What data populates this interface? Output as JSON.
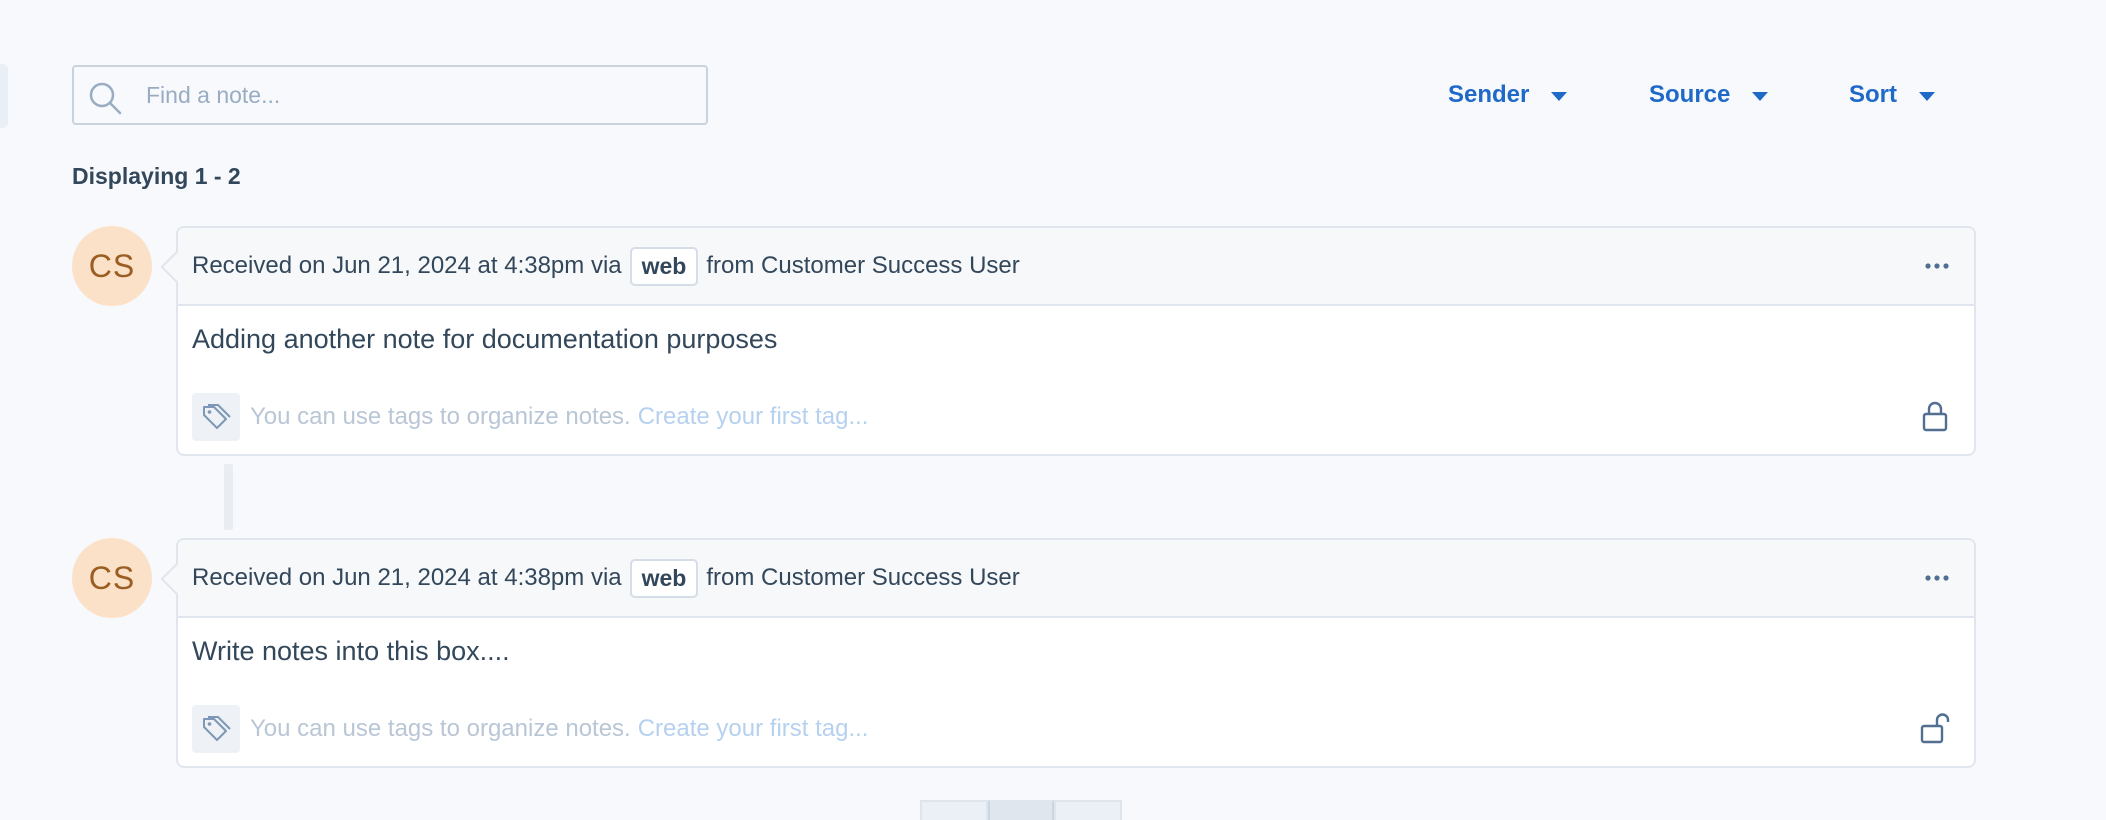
{
  "search": {
    "placeholder": "Find a note..."
  },
  "filters": [
    {
      "label": "Sender"
    },
    {
      "label": "Source"
    },
    {
      "label": "Sort"
    }
  ],
  "results": {
    "count_label": "Displaying 1 - 2"
  },
  "notes": [
    {
      "avatar": "CS",
      "received_prefix": "Received on Jun 21, 2024 at 4:38pm via",
      "source": "web",
      "from_text": "from Customer Success User",
      "body": "Adding another note for documentation purposes",
      "tags_hint": "You can use tags to organize notes.",
      "create_tag": "Create your first tag...",
      "lock_icon": "lock-closed-icon"
    },
    {
      "avatar": "CS",
      "received_prefix": "Received on Jun 21, 2024 at 4:38pm via",
      "source": "web",
      "from_text": "from Customer Success User",
      "body": "Write notes into this box....",
      "tags_hint": "You can use tags to organize notes.",
      "create_tag": "Create your first tag...",
      "lock_icon": "lock-open-icon"
    }
  ],
  "colors": {
    "accent": "#1f69c8",
    "avatar_bg": "#fbe1c8",
    "avatar_text": "#9a5d22",
    "text": "#33475b",
    "muted": "#b9c6d6"
  }
}
